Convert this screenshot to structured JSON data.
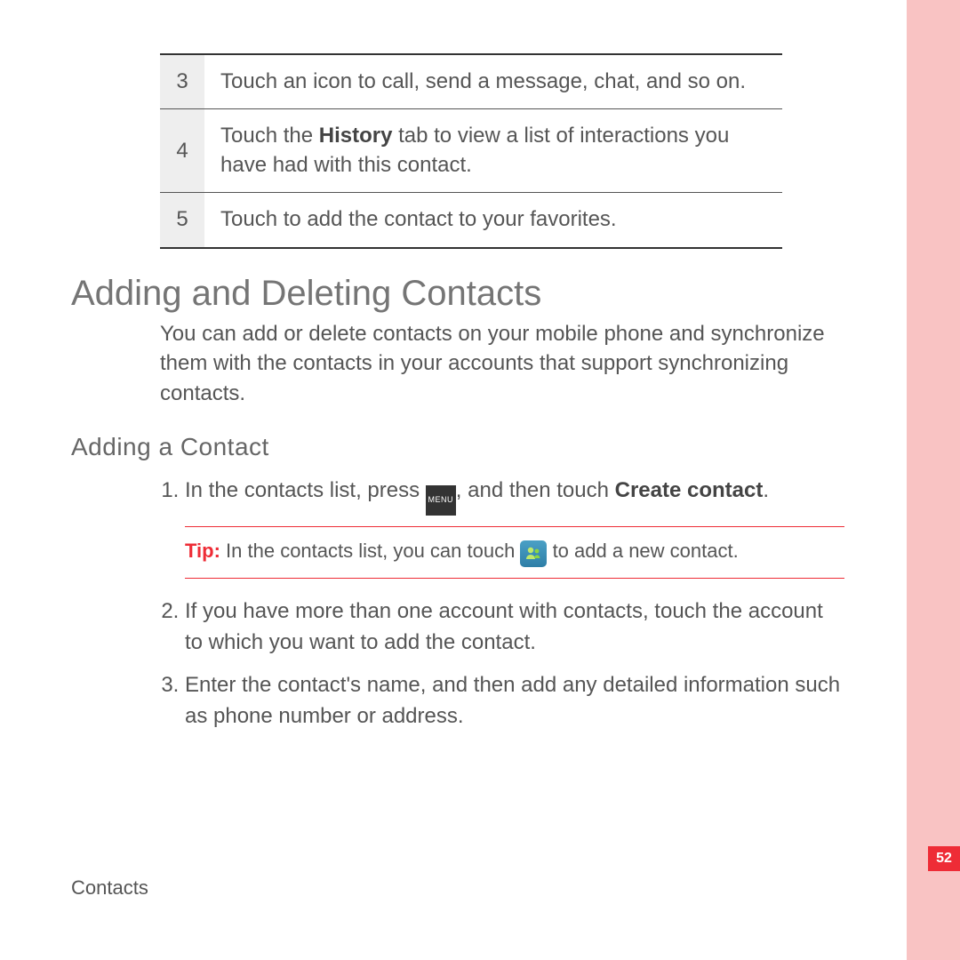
{
  "steps": [
    {
      "num": "3",
      "text": "Touch an icon to call, send a message, chat, and so on."
    },
    {
      "num": "4",
      "pre": "Touch the ",
      "bold": "History",
      "post": " tab to view a list of interactions you have had with this contact."
    },
    {
      "num": "5",
      "text": "Touch to add the contact to your favorites."
    }
  ],
  "section_heading": "Adding and Deleting Contacts",
  "section_body": "You can add or delete contacts on your mobile phone and synchronize them with the contacts in your accounts that support synchronizing contacts.",
  "subheading": "Adding  a  Contact",
  "instructions": {
    "item1": {
      "pre": "In the contacts list, press ",
      "mid": ", and then touch ",
      "bold": "Create contact",
      "post": "."
    },
    "tip": {
      "label": "Tip:",
      "pre": "  In the contacts list, you can touch ",
      "post": " to add a new contact."
    },
    "item2": "If you have more than one account with contacts, touch the account to which you want to add the contact.",
    "item3": "Enter the contact's name, and then add any detailed information such as phone number or address."
  },
  "menu_icon_label": "MENU",
  "footer": "Contacts",
  "page_number": "52"
}
